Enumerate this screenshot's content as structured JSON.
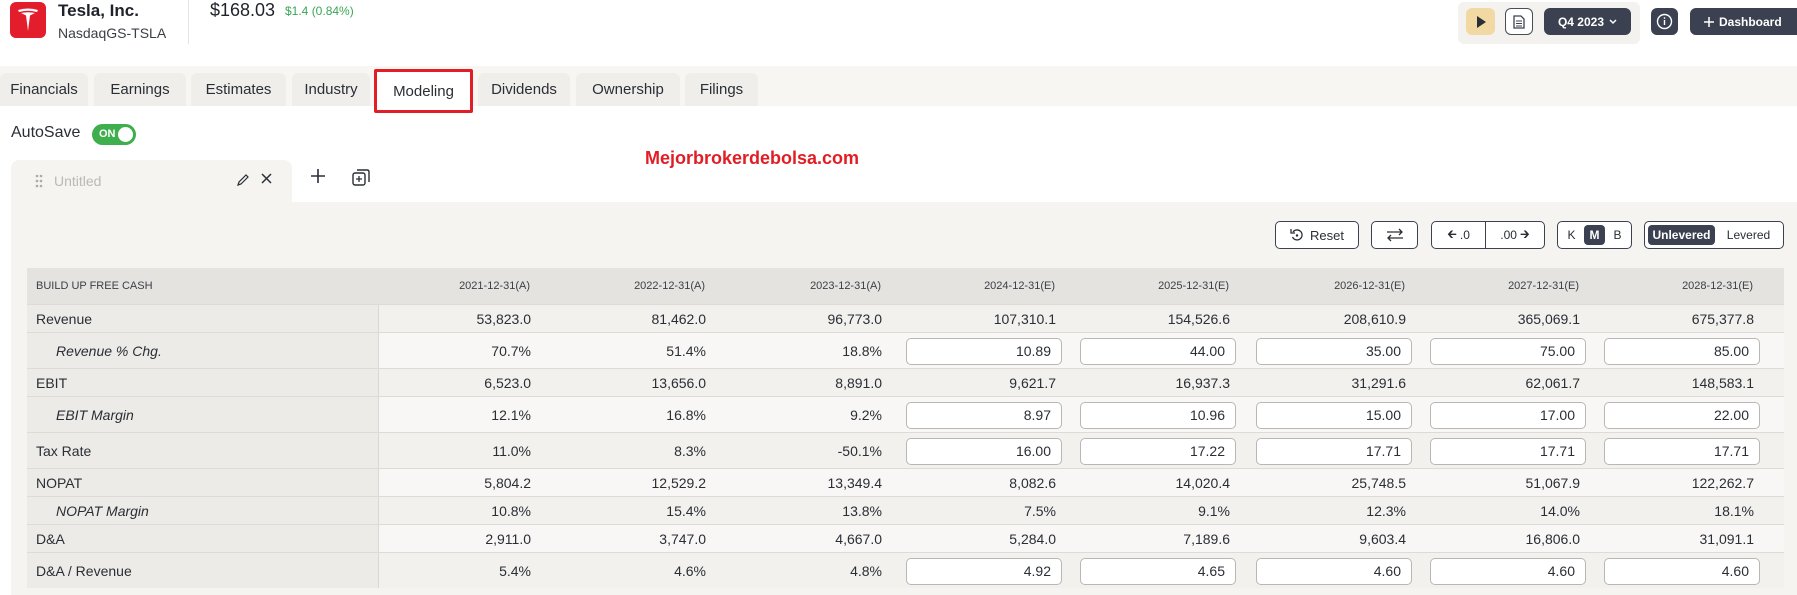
{
  "header": {
    "company_name": "Tesla, Inc.",
    "ticker": "NasdaqGS-TSLA",
    "price": "$168.03",
    "price_change": "$1.4 (0.84%)",
    "period": "Q4 2023",
    "dashboard_label": "Dashboard",
    "brand_color": "#e31d2b",
    "positive_color": "#3aa657"
  },
  "tabs": [
    {
      "label": "Financials",
      "active": false
    },
    {
      "label": "Earnings",
      "active": false
    },
    {
      "label": "Estimates",
      "active": false
    },
    {
      "label": "Industry",
      "active": false
    },
    {
      "label": "Modeling",
      "active": true
    },
    {
      "label": "Dividends",
      "active": false
    },
    {
      "label": "Ownership",
      "active": false
    },
    {
      "label": "Filings",
      "active": false
    }
  ],
  "autosave": {
    "label": "AutoSave",
    "state": "ON"
  },
  "watermark": "Mejorbrokerdebolsa.com",
  "model_tab": {
    "name": "Untitled"
  },
  "controls": {
    "reset_label": "Reset",
    "decimal_decrease": ".0",
    "decimal_increase": ".00",
    "units": [
      "K",
      "M",
      "B"
    ],
    "units_selected": "M",
    "mode": [
      "Unlevered",
      "Levered"
    ],
    "mode_selected": "Unlevered"
  },
  "table": {
    "section_title": "BUILD UP FREE CASH",
    "columns": [
      "2021-12-31(A)",
      "2022-12-31(A)",
      "2023-12-31(A)",
      "2024-12-31(E)",
      "2025-12-31(E)",
      "2026-12-31(E)",
      "2027-12-31(E)",
      "2028-12-31(E)"
    ],
    "rows": [
      {
        "label": "Revenue",
        "sub": false,
        "editable": false,
        "values": [
          "53,823.0",
          "81,462.0",
          "96,773.0",
          "107,310.1",
          "154,526.6",
          "208,610.9",
          "365,069.1",
          "675,377.8"
        ]
      },
      {
        "label": "Revenue % Chg.",
        "sub": true,
        "editable": true,
        "values": [
          "70.7%",
          "51.4%",
          "18.8%",
          "10.89",
          "44.00",
          "35.00",
          "75.00",
          "85.00"
        ]
      },
      {
        "label": "EBIT",
        "sub": false,
        "editable": false,
        "values": [
          "6,523.0",
          "13,656.0",
          "8,891.0",
          "9,621.7",
          "16,937.3",
          "31,291.6",
          "62,061.7",
          "148,583.1"
        ]
      },
      {
        "label": "EBIT Margin",
        "sub": true,
        "editable": true,
        "values": [
          "12.1%",
          "16.8%",
          "9.2%",
          "8.97",
          "10.96",
          "15.00",
          "17.00",
          "22.00"
        ]
      },
      {
        "label": "Tax Rate",
        "sub": false,
        "editable": true,
        "values": [
          "11.0%",
          "8.3%",
          "-50.1%",
          "16.00",
          "17.22",
          "17.71",
          "17.71",
          "17.71"
        ]
      },
      {
        "label": "NOPAT",
        "sub": false,
        "editable": false,
        "values": [
          "5,804.2",
          "12,529.2",
          "13,349.4",
          "8,082.6",
          "14,020.4",
          "25,748.5",
          "51,067.9",
          "122,262.7"
        ]
      },
      {
        "label": "NOPAT Margin",
        "sub": true,
        "editable": false,
        "values": [
          "10.8%",
          "15.4%",
          "13.8%",
          "7.5%",
          "9.1%",
          "12.3%",
          "14.0%",
          "18.1%"
        ]
      },
      {
        "label": "D&A",
        "sub": false,
        "editable": false,
        "values": [
          "2,911.0",
          "3,747.0",
          "4,667.0",
          "5,284.0",
          "7,189.6",
          "9,603.4",
          "16,806.0",
          "31,091.1"
        ]
      },
      {
        "label": "D&A / Revenue",
        "sub": false,
        "editable": true,
        "values": [
          "5.4%",
          "4.6%",
          "4.8%",
          "4.92",
          "4.65",
          "4.60",
          "4.60",
          "4.60"
        ]
      }
    ]
  }
}
